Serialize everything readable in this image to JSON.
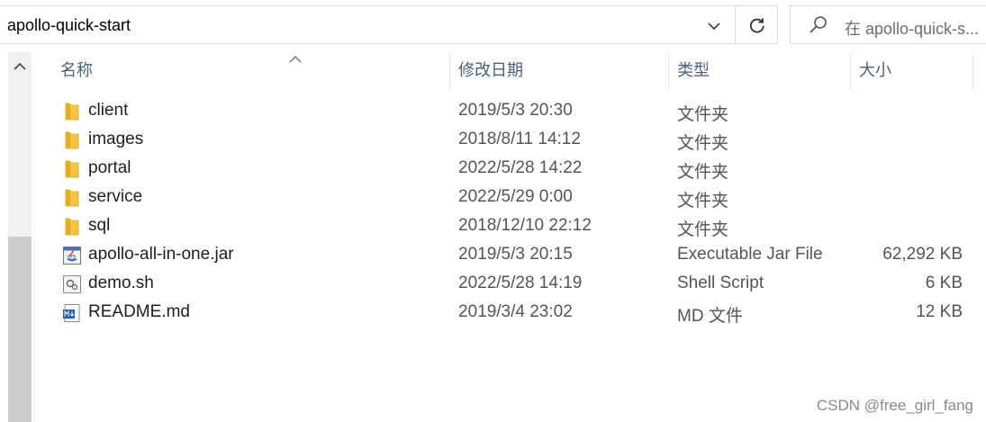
{
  "address_bar": {
    "path": "apollo-quick-start"
  },
  "search": {
    "placeholder": "在 apollo-quick-s..."
  },
  "columns": {
    "name": "名称",
    "modified": "修改日期",
    "type": "类型",
    "size": "大小"
  },
  "files": [
    {
      "name": "client",
      "modified": "2019/5/3 20:30",
      "type": "文件夹",
      "size": "",
      "icon": "folder-icon"
    },
    {
      "name": "images",
      "modified": "2018/8/11 14:12",
      "type": "文件夹",
      "size": "",
      "icon": "folder-icon"
    },
    {
      "name": "portal",
      "modified": "2022/5/28 14:22",
      "type": "文件夹",
      "size": "",
      "icon": "folder-icon"
    },
    {
      "name": "service",
      "modified": "2022/5/29 0:00",
      "type": "文件夹",
      "size": "",
      "icon": "folder-icon"
    },
    {
      "name": "sql",
      "modified": "2018/12/10 22:12",
      "type": "文件夹",
      "size": "",
      "icon": "folder-icon"
    },
    {
      "name": "apollo-all-in-one.jar",
      "modified": "2019/5/3 20:15",
      "type": "Executable Jar File",
      "size": "62,292 KB",
      "icon": "java-jar-icon"
    },
    {
      "name": "demo.sh",
      "modified": "2022/5/28 14:19",
      "type": "Shell Script",
      "size": "6 KB",
      "icon": "shell-script-icon"
    },
    {
      "name": "README.md",
      "modified": "2019/3/4 23:02",
      "type": "MD 文件",
      "size": "12 KB",
      "icon": "markdown-file-icon"
    }
  ],
  "watermark": "CSDN @free_girl_fang",
  "colors": {
    "folder": "#f6c343",
    "header_text": "#4c607a",
    "scrollbar_track": "#f0f0f0",
    "scrollbar_thumb": "#cdcdcd"
  }
}
